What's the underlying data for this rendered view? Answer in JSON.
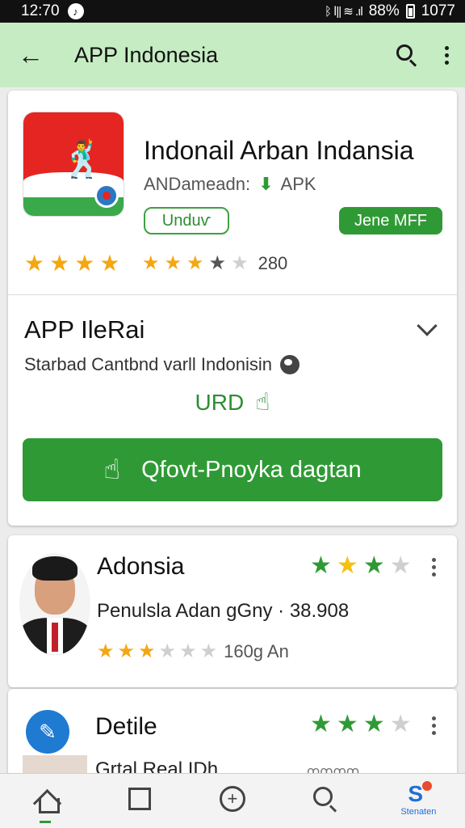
{
  "status_bar": {
    "time": "12:70",
    "notification_glyph": "♪",
    "signal_text": "ᛒ ⅼ|| ≋ .ıl",
    "battery": "88%",
    "extra": "1077"
  },
  "app_bar": {
    "title": "APP Indonesia",
    "back_glyph": "←",
    "background": "#c6ecc3"
  },
  "app_card": {
    "name": "Indonail Arban Indansia",
    "developer_prefix": "ANDameadn:",
    "apk_glyph": "⬇",
    "developer_suffix": "APK",
    "outline_button": "Unduѵ",
    "filled_button": "Jene MFF",
    "rating_count": "280",
    "stars_left": [
      1,
      1,
      1,
      1
    ],
    "stars_right": [
      "on",
      "on",
      "on",
      "dark",
      "off"
    ]
  },
  "info_section": {
    "title": "APP IleRai",
    "description": "Starbad Cantbnd varll Indonisin",
    "urd_label": "URD",
    "hand_glyph": "☝",
    "primary_button": "Qfovt-Pnoyka dagtan",
    "accent": "#2f9a35"
  },
  "list": {
    "items": [
      {
        "name": "Adonsia",
        "subtitle": "Penulsla Adan gGny · 38.908",
        "rating_label": "160g An",
        "rating": 3.5
      },
      {
        "name": "Detile",
        "subtitle": "Grtal Real IDh...",
        "faint_text": "ꝏꝏꝏꝏ",
        "icon_glyph": "✎"
      }
    ]
  },
  "bottom_nav": {
    "items": [
      "home-icon",
      "square-icon",
      "plus-circle-icon",
      "search-icon",
      "store-icon"
    ],
    "active_label": "Stenaten",
    "active_glyph": "S"
  }
}
